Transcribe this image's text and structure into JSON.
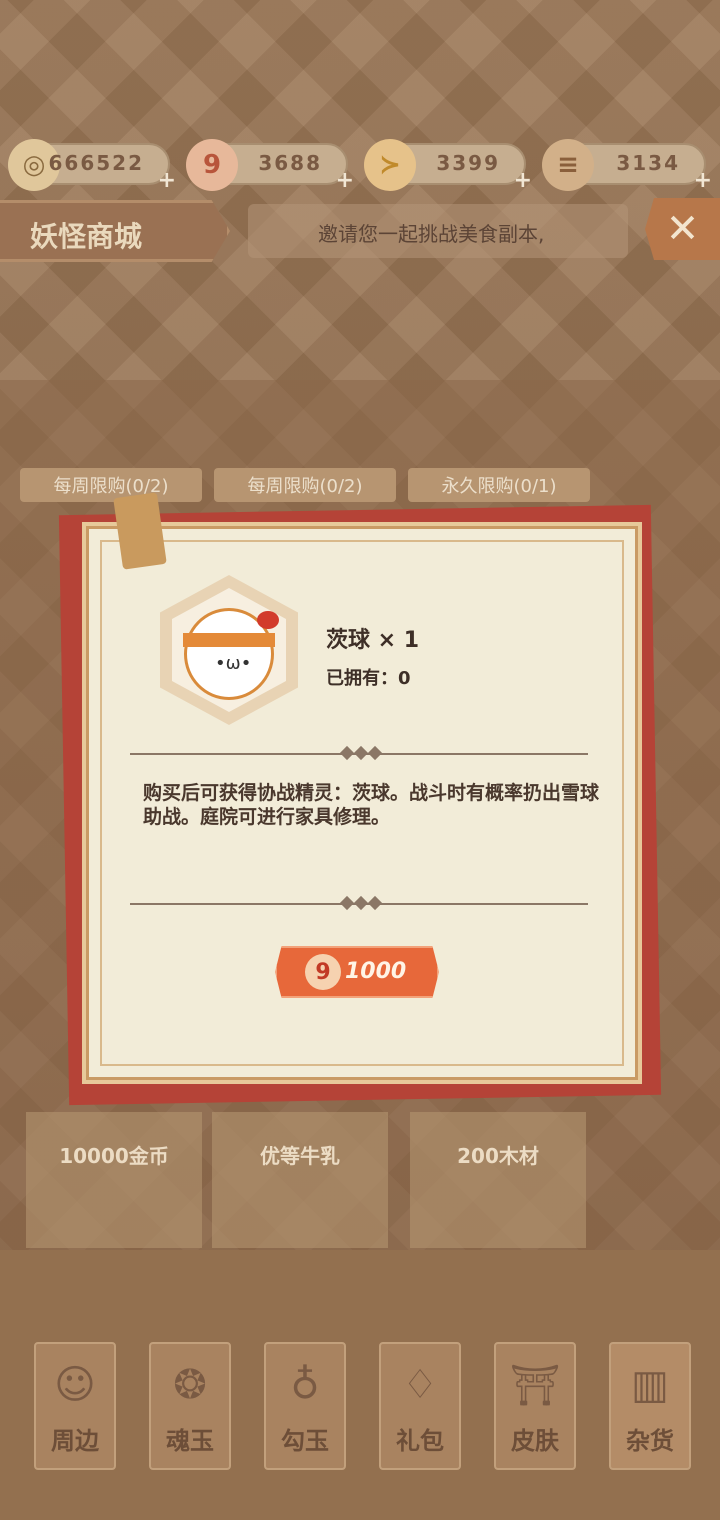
{
  "currencies": [
    {
      "icon": "coin-icon",
      "value": "666522"
    },
    {
      "icon": "magatama-icon",
      "value": "3688"
    },
    {
      "icon": "fish-icon",
      "value": "3399"
    },
    {
      "icon": "wood-icon",
      "value": "3134"
    }
  ],
  "header": {
    "title": "妖怪商城",
    "marquee": "邀请您一起挑战美食副本,"
  },
  "shop": {
    "limit_tabs": [
      "每周限购(0/2)",
      "每周限购(0/2)",
      "永久限购(0/1)"
    ],
    "items": [
      "10000金币",
      "优等牛乳",
      "200木材"
    ]
  },
  "bottom_nav": [
    {
      "label": "周边",
      "icon": "doll-icon"
    },
    {
      "label": "魂玉",
      "icon": "soul-jade-icon"
    },
    {
      "label": "勾玉",
      "icon": "magatama-icon"
    },
    {
      "label": "礼包",
      "icon": "gift-bag-icon"
    },
    {
      "label": "皮肤",
      "icon": "kimono-icon"
    },
    {
      "label": "杂货",
      "icon": "goods-icon"
    }
  ],
  "dialog": {
    "item_name": "茨球 × 1",
    "owned": "已拥有：0",
    "description": "购买后可获得协战精灵：茨球。战斗时有概率扔出雪球助战。庭院可进行家具修理。",
    "price": "1000",
    "price_icon": "magatama-icon"
  }
}
